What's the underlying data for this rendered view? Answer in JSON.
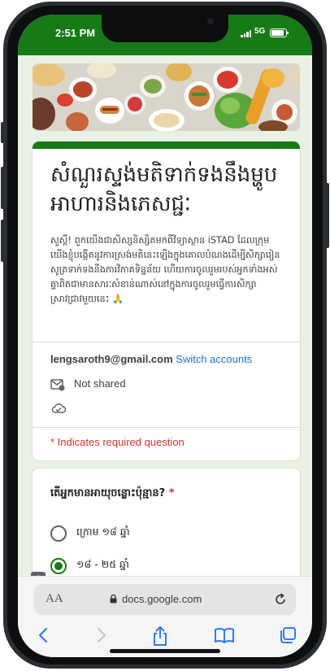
{
  "status_bar": {
    "time": "2:51 PM",
    "network": "5G"
  },
  "form": {
    "title": "សំណួរស្ទង់មតិទាក់ទងនឹងម្ហូបអាហារនិងភេសជ្ជៈ",
    "description": "សួស្តី! ពួកយើងជាសិស្សនិស្សិតមកពីវិទ្យាស្ថាន iSTAD ដែលក្រុមយើងខ្ញុំបង្កើតនូវការស្រង់មតិនេះឡើងក្នុងគោលបំណងដើម្បីសិក្សារៀនសូត្រទាក់ទងនឹងការវិភាគទិន្នន័យ ហើយការចូលរួមរបស់អ្នកទាំងអស់គ្នាពិតជាមានសារៈសំខាន់ណាស់នៅក្នុងការចូលរួមធ្វើការសិក្សាស្រាវជ្រាវមួយនេះ 🙏",
    "account_email": "lengsaroth9@gmail.com",
    "switch_accounts": "Switch accounts",
    "not_shared": "Not shared",
    "required_note": "* Indicates required question"
  },
  "question": {
    "label": "តើអ្នកមានអាយុចន្លោះប៉ុន្មាន?",
    "required_mark": "*",
    "options": [
      "ក្រោម ១៨ ឆ្នាំ",
      "១៨ - ២៥ ឆ្នាំ"
    ],
    "selected_index": 1
  },
  "browser": {
    "text_size_label": "AA",
    "url": "docs.google.com"
  },
  "colors": {
    "theme": "#167a16",
    "link": "#1a73e8",
    "required": "#d93025"
  },
  "icons": [
    "mail-icon",
    "cloud-check-icon",
    "feedback-icon",
    "lock-icon",
    "reload-icon",
    "back-icon",
    "forward-icon",
    "share-icon",
    "bookmarks-icon",
    "tabs-icon"
  ]
}
